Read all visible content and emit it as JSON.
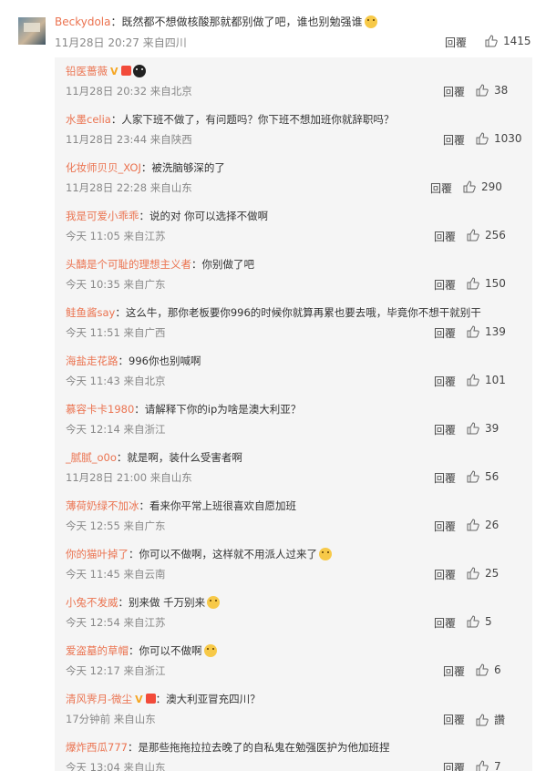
{
  "top_comment": {
    "user": "Beckydola",
    "text": "：既然都不想做核酸那就都别做了吧，谁也别勉强谁",
    "meta": "11月28日 20:27 来自四川",
    "reply_label": "回覆",
    "likes": "1415"
  },
  "replies": [
    {
      "user": "铅医蔷薇",
      "text": "",
      "meta": "11月28日 20:32 来自北京",
      "reply_label": "回覆",
      "likes": "38",
      "vip": "V",
      "emoji": "dark"
    },
    {
      "user": "水墨celia",
      "text": "：人家下班不做了，有问题吗？你下班不想加班你就辞职吗？",
      "meta": "11月28日 23:44 来自陕西",
      "reply_label": "回覆",
      "likes": "1030"
    },
    {
      "user": "化妆师贝贝_XOJ",
      "text": "：被洗脑够深的了",
      "meta": "11月28日 22:28 来自山东",
      "reply_label": "回覆",
      "likes": "290"
    },
    {
      "user": "我是可爱小乖乖",
      "text": "：说的对 你可以选择不做啊",
      "meta": "今天 11:05 来自江苏",
      "reply_label": "回覆",
      "likes": "256"
    },
    {
      "user": "头醻是个可耻的理想主义者",
      "text": "：你别做了吧",
      "meta": "今天 10:35 来自广东",
      "reply_label": "回覆",
      "likes": "150"
    },
    {
      "user": "鲑鱼酱say",
      "text": "：这么牛，那你老板要你996的时候你就算再累也要去哦，毕竟你不想干就别干",
      "meta": "今天 11:51 来自广西",
      "reply_label": "回覆",
      "likes": "139"
    },
    {
      "user": "海盐走花路",
      "text": "：996你也别喊啊",
      "meta": "今天 11:43 来自北京",
      "reply_label": "回覆",
      "likes": "101"
    },
    {
      "user": "慕容卡卡1980",
      "text": "：请解释下你的ip为啥是澳大利亚？",
      "meta": "今天 12:14 来自浙江",
      "reply_label": "回覆",
      "likes": "39"
    },
    {
      "user": "_腻腻_o0o",
      "text": "：就是啊，装什么受害者啊",
      "meta": "11月28日 21:00 来自山东",
      "reply_label": "回覆",
      "likes": "56"
    },
    {
      "user": "薄荷奶绿不加冰",
      "text": "：看来你平常上班很喜欢自愿加班",
      "meta": "今天 12:55 来自广东",
      "reply_label": "回覆",
      "likes": "26"
    },
    {
      "user": "你的猫叶掉了",
      "text": "：你可以不做啊，这样就不用派人过来了",
      "meta": "今天 11:45 来自云南",
      "reply_label": "回覆",
      "likes": "25",
      "emoji": "face"
    },
    {
      "user": "小兔不发威",
      "text": "：别来做 千万别来",
      "meta": "今天 12:54 来自江苏",
      "reply_label": "回覆",
      "likes": "5",
      "emoji": "face"
    },
    {
      "user": "爱盗墓的草帽",
      "text": "：你可以不做啊",
      "meta": "今天 12:17 来自浙江",
      "reply_label": "回覆",
      "likes": "6",
      "emoji": "face"
    },
    {
      "user": "清风霁月-微尘",
      "text": "：澳大利亚冒充四川？",
      "meta": "17分钟前 来自山东",
      "reply_label": "回覆",
      "likes": "讚",
      "vip": "V"
    },
    {
      "user": "爆炸西瓜777",
      "text": "：是那些拖拖拉拉去晚了的自私鬼在勉强医护为他加班捏",
      "meta": "今天 13:04 来自山东",
      "reply_label": "回覆",
      "likes": "7"
    }
  ]
}
